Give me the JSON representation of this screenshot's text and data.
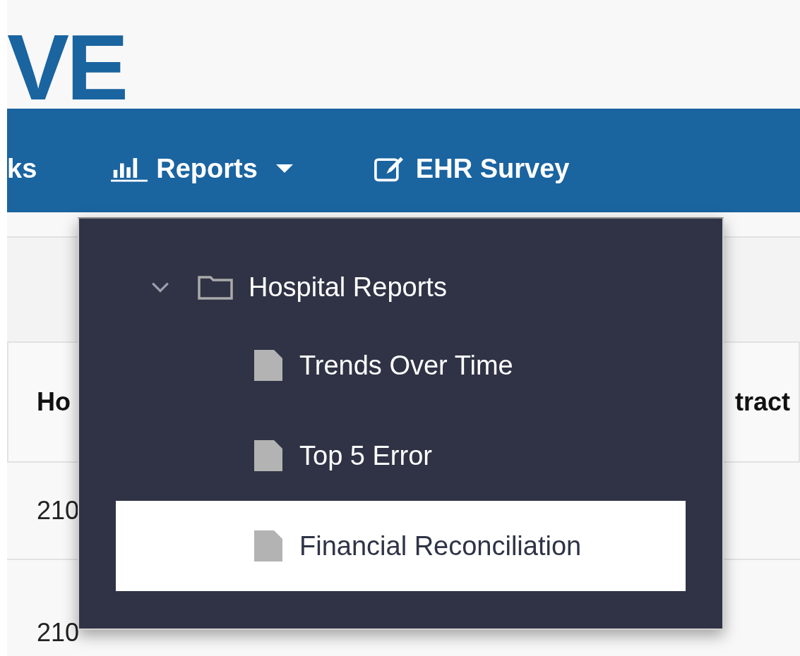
{
  "logo": {
    "text": "VE"
  },
  "nav": [
    {
      "label": "ks",
      "kind": "plain",
      "caret": false
    },
    {
      "label": "Reports",
      "kind": "chart",
      "caret": true
    },
    {
      "label": "EHR Survey",
      "kind": "edit",
      "caret": false
    }
  ],
  "table": {
    "columns": [
      {
        "label": "Ho"
      },
      {
        "label": "tract"
      }
    ],
    "rows": [
      [
        "210"
      ],
      [
        "210"
      ]
    ]
  },
  "menu": {
    "folder": {
      "label": "Hospital Reports",
      "expanded": true,
      "children": [
        {
          "label": "Trends Over Time",
          "selected": false
        },
        {
          "label": "Top 5 Error",
          "selected": false
        },
        {
          "label": "Financial Reconciliation",
          "selected": true
        }
      ]
    }
  }
}
